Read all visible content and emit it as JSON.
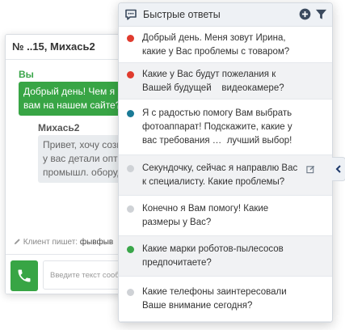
{
  "chat": {
    "title": "№ ..15, Михась2",
    "me_author": "Вы",
    "me_message": "Добрый день! Чем я\nвам на нашем сайте?",
    "other_author": "Михась2",
    "other_message": "Привет, хочу созв\nу вас детали опто\nпромышл. оборуд",
    "typing_label": "Клиент пишет:",
    "typing_text": "фывфыв",
    "input_placeholder": "Введите текст сооб"
  },
  "quick_answers": {
    "title": "Быстрые ответы",
    "items": [
      {
        "text": "Добрый день. Меня зовут Ирина,\nкакие у Вас проблемы с товаром?",
        "color": "#e03b2e"
      },
      {
        "text": "Какие у Вас будут пожелания к\nВашей будущей    видеокамере?",
        "color": "#e03b2e"
      },
      {
        "text": "Я с радостью помогу Вам выбрать\nфотоаппарат! Подскажите, какие у\nвас требования …  лучший выбор!",
        "color": "#1a7a96"
      },
      {
        "text": "Секундочку, сейчас я направлю Вас\nк специалисту. Какие проблемы?",
        "color": "#cfd2d6"
      },
      {
        "text": "Конечно я Вам помогу! Какие\nразмеры у Вас?",
        "color": "#cfd2d6"
      },
      {
        "text": "Какие марки роботов-пылесосов\nпредпочитаете?",
        "color": "#3aa64a"
      },
      {
        "text": "Какие телефоны заинтересовали\nВаше внимание сегодня?",
        "color": "#cfd2d6"
      }
    ]
  },
  "colors": {
    "accent_green": "#38a545",
    "panel_header": "#eef1f5",
    "icon_blue": "#3b4a5e"
  },
  "icons": {
    "panel": "chat-bubble-icon",
    "add": "plus-circle-icon",
    "filter": "filter-icon",
    "edit": "edit-icon",
    "collapse": "chevron-left-icon",
    "call": "phone-icon",
    "typing": "pencil-icon"
  }
}
